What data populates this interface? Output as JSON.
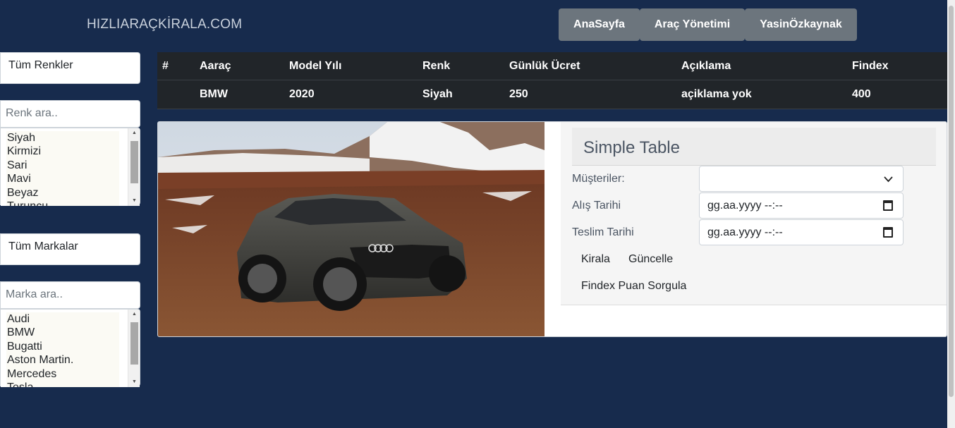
{
  "brand": "HIZLIARAÇKİRALA.COM",
  "nav": {
    "home": "AnaSayfa",
    "vehicle_management": "Araç Yönetimi",
    "user": "YasinÖzkaynak"
  },
  "colors_filter": {
    "title": "Tüm Renkler",
    "search_placeholder": "Renk ara..",
    "options": [
      "Siyah",
      "Kirmizi",
      "Sari",
      "Mavi",
      "Beyaz",
      "Turuncu"
    ]
  },
  "brands_filter": {
    "title": "Tüm Markalar",
    "search_placeholder": "Marka ara..",
    "options": [
      "Audi",
      "BMW",
      "Bugatti",
      "Aston Martin.",
      "Mercedes",
      "Tesla"
    ]
  },
  "table": {
    "headers": [
      "#",
      "Aaraç",
      "Model Yılı",
      "Renk",
      "Günlük Ücret",
      "Açıklama",
      "Findex"
    ],
    "row": {
      "id": "",
      "brand": "BMW",
      "model_year": "2020",
      "color": "Siyah",
      "daily_price": "250",
      "description": "açiklama yok",
      "findex": "400"
    }
  },
  "rental_panel": {
    "title": "Simple Table",
    "customers_label": "Müşteriler:",
    "customers_value": "",
    "pickup_label": "Alış Tarihi",
    "pickup_value": "gg.aa.yyyy --:--",
    "return_label": "Teslim Tarihi",
    "return_value": "gg.aa.yyyy --:--",
    "rent_button": "Kirala",
    "update_button": "Güncelle",
    "findex_button": "Findex Puan Sorgula"
  },
  "icons": [
    "chevron-down-icon",
    "calendar-icon",
    "scroll-up-icon",
    "scroll-down-icon"
  ]
}
